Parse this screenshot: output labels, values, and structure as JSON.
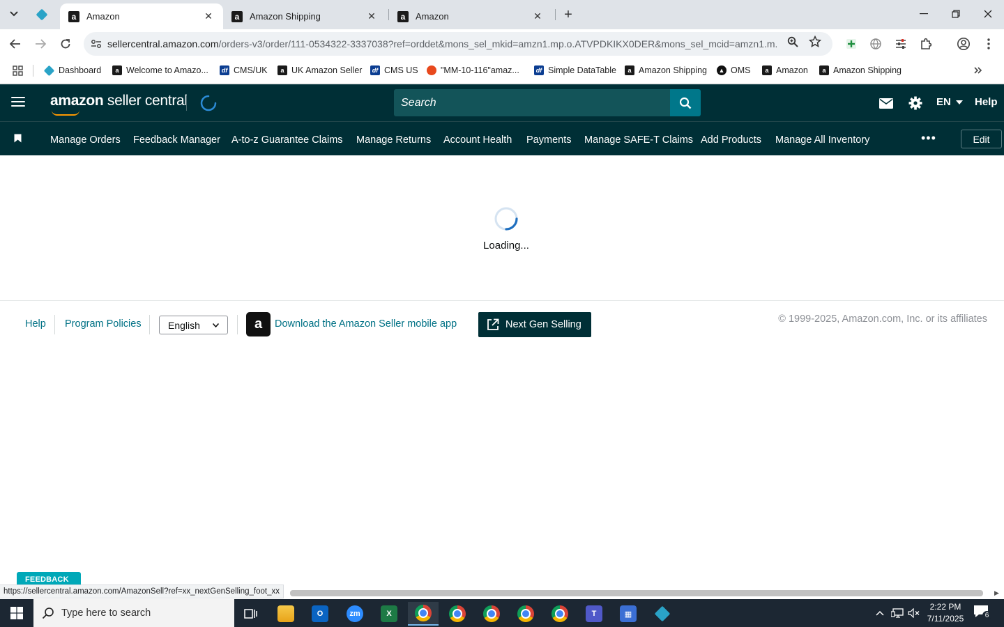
{
  "browser": {
    "tabs": [
      {
        "title": "Amazon",
        "active": true
      },
      {
        "title": "Amazon Shipping",
        "active": false
      },
      {
        "title": "Amazon",
        "active": false
      }
    ],
    "url_host": "sellercentral.amazon.com",
    "url_path": "/orders-v3/order/111-0534322-3337038?ref=orddet&mons_sel_mkid=amzn1.mp.o.ATVPDKIKX0DER&mons_sel_mcid=amzn1.m...",
    "bookmarks": [
      {
        "label": "Dashboard",
        "icon": "diamond"
      },
      {
        "label": "Welcome to Amazo...",
        "icon": "a"
      },
      {
        "label": "CMS/UK",
        "icon": "df"
      },
      {
        "label": "UK Amazon Seller",
        "icon": "a"
      },
      {
        "label": "CMS US",
        "icon": "df"
      },
      {
        "label": "\"MM-10-116\"amaz...",
        "icon": "dd"
      },
      {
        "label": "Simple DataTable",
        "icon": "df"
      },
      {
        "label": "Amazon Shipping",
        "icon": "a"
      },
      {
        "label": "OMS",
        "icon": "oms"
      },
      {
        "label": "Amazon",
        "icon": "a"
      },
      {
        "label": "Amazon Shipping",
        "icon": "a"
      }
    ]
  },
  "header": {
    "logo_bold": "amazon",
    "logo_rest": " seller central",
    "search_placeholder": "Search",
    "language": "EN",
    "help": "Help"
  },
  "nav": {
    "links": [
      "Manage Orders",
      "Feedback Manager",
      "A-to-z Guarantee Claims",
      "Manage Returns",
      "Account Health",
      "Payments",
      "Manage SAFE-T Claims",
      "Add Products",
      "Manage All Inventory"
    ],
    "more": "•••",
    "edit": "Edit"
  },
  "main": {
    "loading_text": "Loading..."
  },
  "footer": {
    "help": "Help",
    "program_policies": "Program Policies",
    "language_selected": "English",
    "app_download": "Download the Amazon Seller mobile app",
    "next_gen": "Next Gen Selling",
    "copyright": "© 1999-2025, Amazon.com, Inc. or its affiliates"
  },
  "feedback": {
    "label": "FEEDBACK"
  },
  "status_url": "https://sellercentral.amazon.com/AmazonSell?ref=xx_nextGenSelling_foot_xx",
  "taskbar": {
    "search_placeholder": "Type here to search",
    "time": "2:22 PM",
    "date": "7/11/2025",
    "notification_count": "6"
  },
  "colors": {
    "header_bg": "#002f36",
    "search_bg": "#135459",
    "search_btn": "#00778a",
    "link": "#007185",
    "feedback_bg": "#00a8b8"
  }
}
